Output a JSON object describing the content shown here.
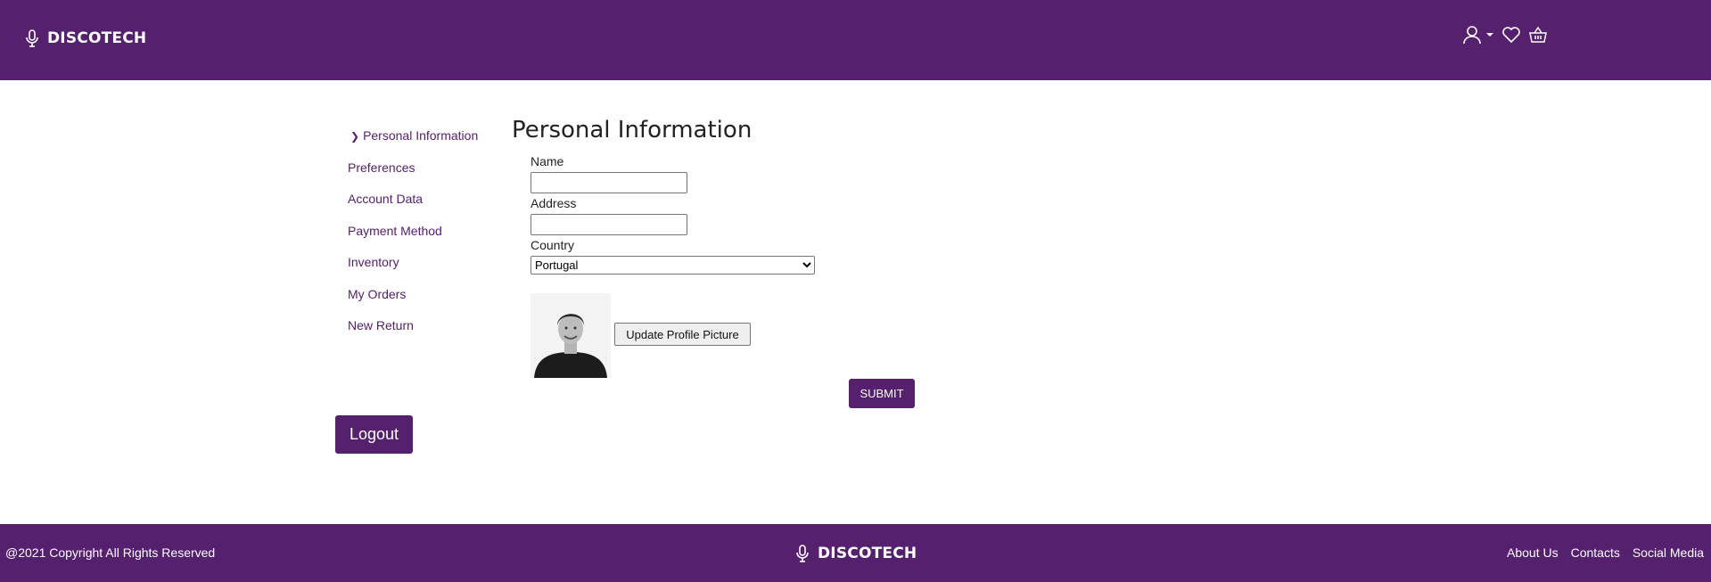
{
  "header": {
    "brand": "DISCOTECH",
    "icons": [
      "user-icon",
      "caret-down-icon",
      "heart-icon",
      "basket-icon"
    ]
  },
  "sidebar": {
    "items": [
      {
        "label": "Personal Information",
        "active": true
      },
      {
        "label": "Preferences"
      },
      {
        "label": "Account Data"
      },
      {
        "label": "Payment Method"
      },
      {
        "label": "Inventory"
      },
      {
        "label": "My Orders"
      },
      {
        "label": "New Return"
      }
    ],
    "logout_label": "Logout"
  },
  "main": {
    "title": "Personal Information",
    "name_label": "Name",
    "name_value": "",
    "address_label": "Address",
    "address_value": "",
    "country_label": "Country",
    "country_value": "Portugal",
    "update_picture_label": "Update Profile Picture",
    "submit_label": "SUBMIT"
  },
  "footer": {
    "copyright": "@2021 Copyright All Rights Reserved",
    "brand": "DISCOTECH",
    "links": [
      "About Us",
      "Contacts",
      "Social Media"
    ]
  },
  "colors": {
    "brand_purple": "#55206e",
    "white": "#ffffff"
  }
}
